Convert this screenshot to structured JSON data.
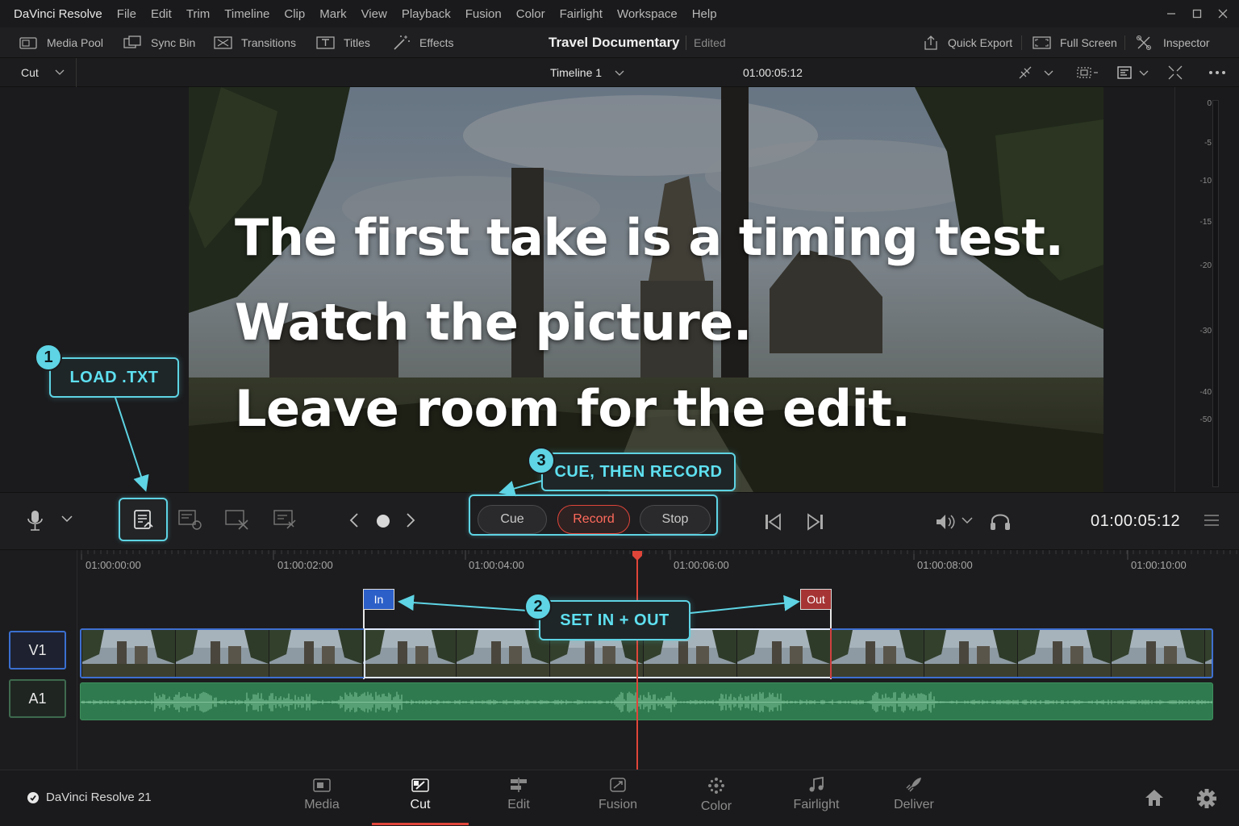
{
  "menubar": {
    "app_name": "DaVinci Resolve",
    "menus": [
      "File",
      "Edit",
      "Trim",
      "Timeline",
      "Clip",
      "Mark",
      "View",
      "Playback",
      "Fusion",
      "Color",
      "Fairlight",
      "Workspace",
      "Help"
    ]
  },
  "toolbar": {
    "media_pool": "Media Pool",
    "sync_bin": "Sync Bin",
    "transitions": "Transitions",
    "titles": "Titles",
    "effects": "Effects",
    "project_title": "Travel Documentary",
    "project_status": "Edited",
    "quick_export": "Quick Export",
    "full_screen": "Full Screen",
    "inspector": "Inspector"
  },
  "row2": {
    "mode": "Cut",
    "timeline_name": "Timeline 1",
    "timecode": "01:00:05:12"
  },
  "viewer": {
    "lines": [
      "The first take is a timing test.",
      "Watch the picture.",
      "Leave room for the edit."
    ]
  },
  "meter": {
    "labels": [
      "0",
      "-5",
      "-10",
      "-15",
      "-20",
      "-30",
      "-40",
      "-50"
    ]
  },
  "transport": {
    "cue": "Cue",
    "record": "Record",
    "stop": "Stop",
    "timecode": "01:00:05:12"
  },
  "timeline": {
    "ruler": [
      "01:00:00:00",
      "01:00:02:00",
      "01:00:04:00",
      "01:00:06:00",
      "01:00:08:00",
      "01:00:10:00"
    ],
    "in_label": "In",
    "out_label": "Out",
    "v1": "V1",
    "a1": "A1"
  },
  "annotations": {
    "step1_num": "1",
    "step1_text": "LOAD .TXT",
    "step2_num": "2",
    "step2_text": "SET IN + OUT",
    "step3_num": "3",
    "step3_text": "CUE, THEN RECORD"
  },
  "pagebar": {
    "brand": "DaVinci Resolve 21",
    "pages": [
      "Media",
      "Cut",
      "Edit",
      "Fusion",
      "Color",
      "Fairlight",
      "Deliver"
    ],
    "active_page": "Cut"
  },
  "colors": {
    "accent_cyan": "#5ed4e4",
    "record_red": "#e0453a",
    "in_blue": "#2c5fc8",
    "out_red": "#a63434",
    "audio_green": "#2f7a4e"
  }
}
